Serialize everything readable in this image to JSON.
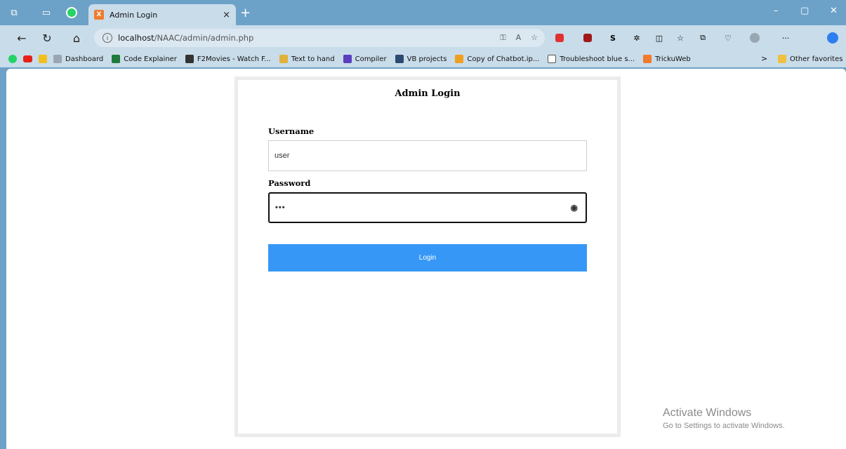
{
  "browser": {
    "tab_title": "Admin Login",
    "tab_close": "×",
    "new_tab": "+",
    "url_host": "localhost",
    "url_path": "/NAAC/admin/admin.php",
    "more": "···",
    "window_min": "–",
    "window_restore": "▢",
    "window_close": "✕"
  },
  "bookmarks": [
    {
      "label": "Dashboard",
      "color": "#9aa7b3"
    },
    {
      "label": "Code Explainer",
      "color": "#1f7a3e"
    },
    {
      "label": "F2Movies - Watch F...",
      "color": "#333333"
    },
    {
      "label": "Text to hand",
      "color": "#e0b23a"
    },
    {
      "label": "Compiler",
      "color": "#5a3fbf"
    },
    {
      "label": "VB projects",
      "color": "#2b4a6f"
    },
    {
      "label": "Copy of Chatbot.ip...",
      "color": "#f0a020"
    },
    {
      "label": "Troubleshoot blue s...",
      "color": "#ffffff"
    },
    {
      "label": "TrickuWeb",
      "color": "#f07a2e"
    }
  ],
  "bookmarks_more": ">",
  "other_favorites": "Other favorites",
  "page": {
    "heading": "Admin Login",
    "username_label": "Username",
    "username_value": "user",
    "password_label": "Password",
    "password_value": "•••",
    "login_button": "Login"
  },
  "watermark": {
    "line1": "Activate Windows",
    "line2": "Go to Settings to activate Windows."
  },
  "colors": {
    "accent": "#3797f6",
    "chrome": "#6da2c8",
    "toolbar": "#c9dcea"
  }
}
